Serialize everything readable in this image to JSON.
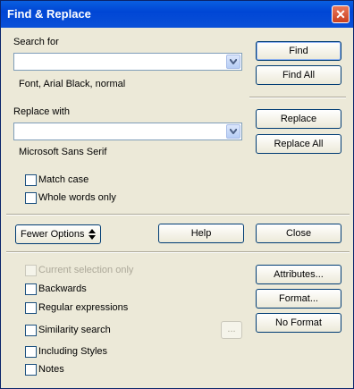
{
  "window": {
    "title": "Find & Replace",
    "close_glyph": "✕"
  },
  "search": {
    "label": "Search for",
    "value": "",
    "attributes_text": "Font, Arial Black, normal"
  },
  "replace": {
    "label": "Replace with",
    "value": "",
    "attributes_text": "Microsoft Sans Serif"
  },
  "buttons": {
    "find": "Find",
    "find_all": "Find All",
    "replace": "Replace",
    "replace_all": "Replace All",
    "fewer_options": "Fewer Options",
    "help": "Help",
    "close": "Close",
    "attributes": "Attributes...",
    "format": "Format...",
    "no_format": "No Format",
    "similarity_dots": "..."
  },
  "options": {
    "match_case": "Match case",
    "whole_words": "Whole words only",
    "current_selection": "Current selection only",
    "backwards": "Backwards",
    "regex": "Regular expressions",
    "similarity": "Similarity search",
    "including_styles": "Including Styles",
    "notes": "Notes"
  },
  "icons": {
    "dropdown": "chevron-down-icon",
    "fewer": "up-down-arrows-icon",
    "close": "close-icon"
  },
  "colors": {
    "titlebar": "#0046d5",
    "dialog_bg": "#ece9d8",
    "close_btn": "#c9401f"
  }
}
